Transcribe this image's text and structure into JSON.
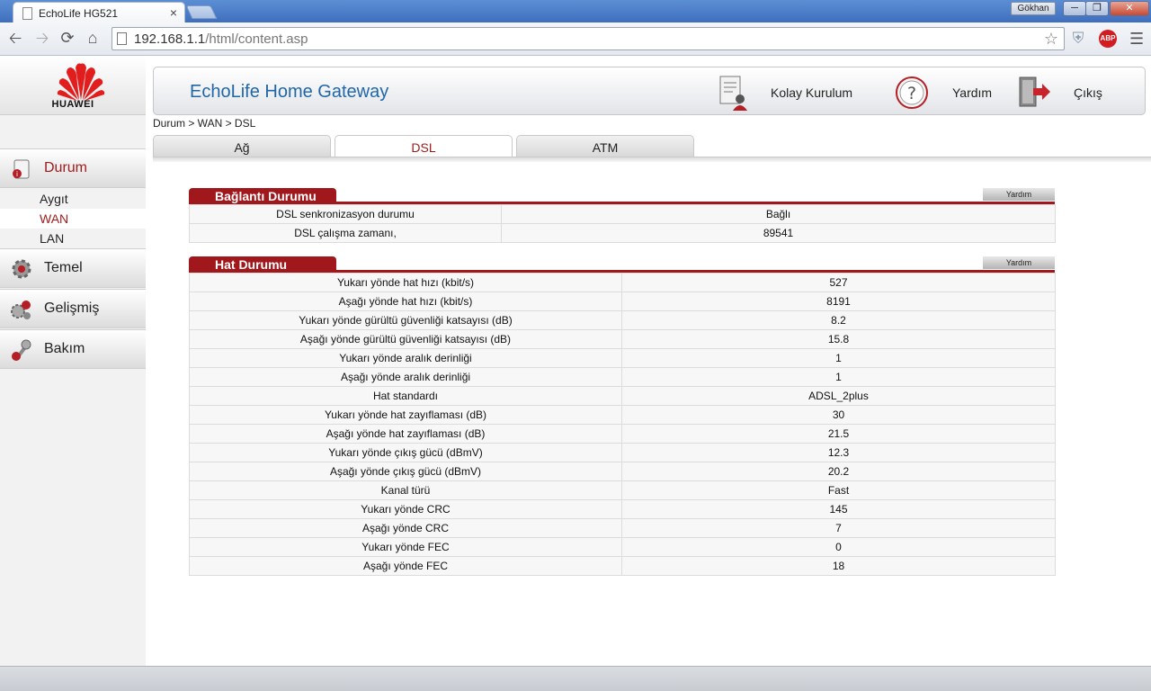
{
  "browser": {
    "tab_title": "EchoLife HG521",
    "tab_close": "×",
    "user_name": "Gökhan",
    "url_host": "192.168.1.1",
    "url_path": "/html/content.asp",
    "abp_label": "ABP"
  },
  "brand": {
    "logo_text": "HUAWEI",
    "accent": "#a0171c",
    "title_color": "#2167a8"
  },
  "header": {
    "title": "EchoLife Home Gateway",
    "quick_setup": "Kolay Kurulum",
    "help": "Yardım",
    "logout": "Çıkış"
  },
  "sidebar": {
    "sections": [
      {
        "label": "Durum",
        "icon": "status-icon",
        "active": true
      },
      {
        "label": "Temel",
        "icon": "basic-gear-icon"
      },
      {
        "label": "Gelişmiş",
        "icon": "advanced-icon"
      },
      {
        "label": "Bakım",
        "icon": "maintenance-icon"
      }
    ],
    "status_items": [
      "Aygıt",
      "WAN",
      "LAN"
    ]
  },
  "breadcrumb": "Durum > WAN > DSL",
  "tabs": [
    "Ağ",
    "DSL",
    "ATM"
  ],
  "connection": {
    "title": "Bağlantı Durumu",
    "help": "Yardım",
    "rows": [
      {
        "label": "DSL senkronizasyon durumu",
        "value": "Bağlı"
      },
      {
        "label": "DSL çalışma zamanı,",
        "value": "89541"
      }
    ]
  },
  "line": {
    "title": "Hat Durumu",
    "help": "Yardım",
    "rows": [
      {
        "label": "Yukarı yönde hat hızı (kbit/s)",
        "value": "527"
      },
      {
        "label": "Aşağı yönde hat hızı (kbit/s)",
        "value": "8191"
      },
      {
        "label": "Yukarı yönde gürültü güvenliği katsayısı (dB)",
        "value": "8.2"
      },
      {
        "label": "Aşağı yönde gürültü güvenliği katsayısı (dB)",
        "value": "15.8"
      },
      {
        "label": "Yukarı yönde aralık derinliği",
        "value": "1"
      },
      {
        "label": "Aşağı yönde aralık derinliği",
        "value": "1"
      },
      {
        "label": "Hat standardı",
        "value": "ADSL_2plus"
      },
      {
        "label": "Yukarı yönde hat zayıflaması (dB)",
        "value": "30"
      },
      {
        "label": "Aşağı yönde hat zayıflaması (dB)",
        "value": "21.5"
      },
      {
        "label": "Yukarı yönde çıkış gücü (dBmV)",
        "value": "12.3"
      },
      {
        "label": "Aşağı yönde çıkış gücü (dBmV)",
        "value": "20.2"
      },
      {
        "label": "Kanal türü",
        "value": "Fast"
      },
      {
        "label": "Yukarı yönde CRC",
        "value": "145"
      },
      {
        "label": "Aşağı yönde CRC",
        "value": "7"
      },
      {
        "label": "Yukarı yönde FEC",
        "value": "0"
      },
      {
        "label": "Aşağı yönde FEC",
        "value": "18"
      }
    ]
  }
}
